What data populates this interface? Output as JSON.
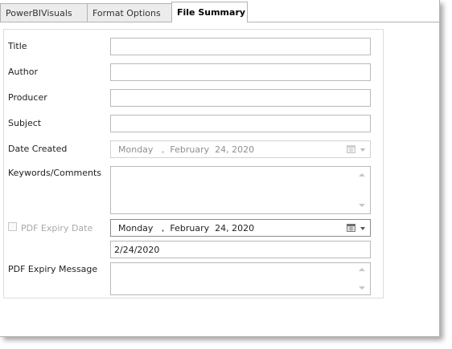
{
  "tabs": [
    {
      "label": "PowerBIVisuals"
    },
    {
      "label": "Format Options"
    },
    {
      "label": "File Summary"
    }
  ],
  "form": {
    "title_label": "Title",
    "author_label": "Author",
    "producer_label": "Producer",
    "subject_label": "Subject",
    "date_created_label": "Date Created",
    "date_created_value": "Monday   ,  February  24, 2020",
    "keywords_label": "Keywords/Comments",
    "pdf_expiry_date_label": "PDF Expiry Date",
    "pdf_expiry_date_checked": false,
    "pdf_expiry_date_value": "Monday   ,  February  24, 2020",
    "pdf_expiry_date_short": "2/24/2020",
    "pdf_expiry_message_label": "PDF Expiry Message"
  },
  "icons": {
    "calendar": "calendar-icon",
    "dropdown": "chevron-down-icon"
  },
  "colors": {
    "disabled_text": "#8e8e8e",
    "border": "#b9b9b9"
  }
}
